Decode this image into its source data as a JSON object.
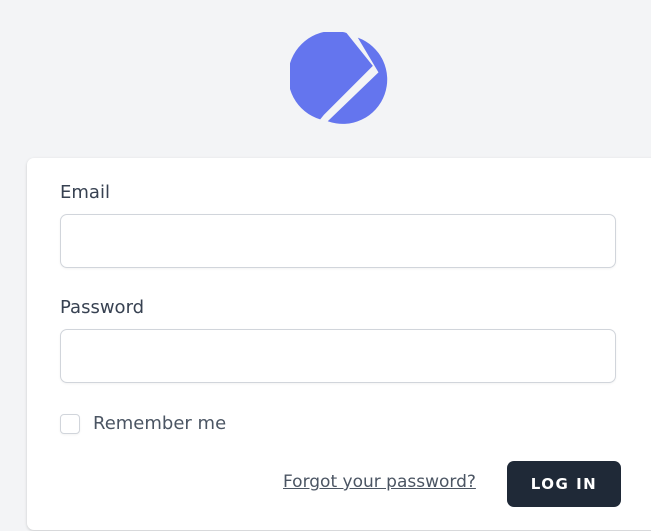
{
  "colors": {
    "background": "#f3f4f6",
    "card": "#ffffff",
    "logo": "#6475ee",
    "button": "#1f2937",
    "label": "#374151"
  },
  "logo": {
    "icon": "planet-logo-icon"
  },
  "form": {
    "email_label": "Email",
    "email_value": "",
    "password_label": "Password",
    "password_value": "",
    "remember_label": "Remember me",
    "remember_checked": false,
    "forgot_link": "Forgot your password?",
    "login_button": "LOG IN"
  }
}
